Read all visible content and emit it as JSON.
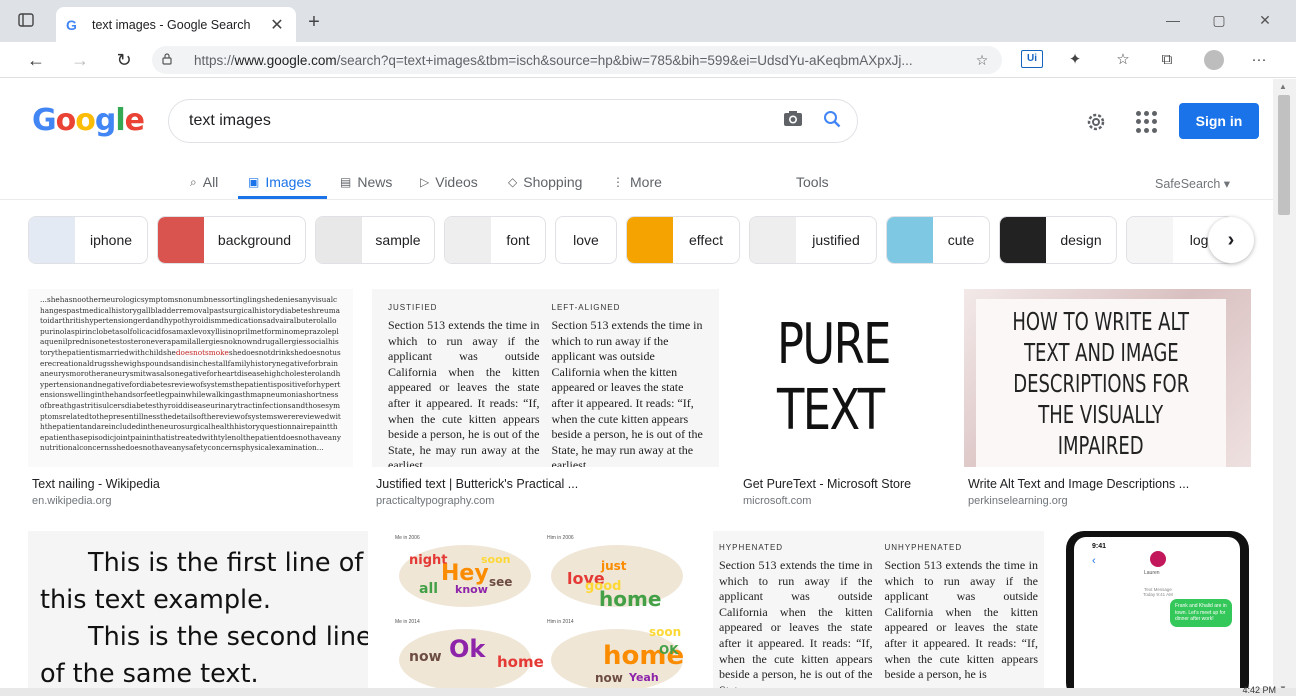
{
  "browser": {
    "tab_title": "text images - Google Search",
    "favicon": "G",
    "new_tab": "+",
    "url_prefix": "https://",
    "url_host": "www.google.com",
    "url_path": "/search?q=text+images&tbm=isch&source=hp&biw=785&bih=599&ei=UdsdYu-aKeqbmAXpxJj...",
    "nav": {
      "back": "←",
      "forward": "→",
      "reload": "↻"
    },
    "window": {
      "minimize": "—",
      "maximize": "▢",
      "close": "✕"
    },
    "tab_close": "✕",
    "toolbar_icons": {
      "ui_badge": "Ui",
      "extensions": "✦",
      "favorites": "☆",
      "collections": "⧉",
      "more": "···"
    }
  },
  "google": {
    "logo_letters": [
      {
        "ch": "G",
        "color": "#4285f4"
      },
      {
        "ch": "o",
        "color": "#ea4335"
      },
      {
        "ch": "o",
        "color": "#fbbc05"
      },
      {
        "ch": "g",
        "color": "#4285f4"
      },
      {
        "ch": "l",
        "color": "#34a853"
      },
      {
        "ch": "e",
        "color": "#ea4335"
      }
    ],
    "query": "text images",
    "sign_in": "Sign in",
    "accent": "#1a73e8"
  },
  "tabs": {
    "all": "All",
    "images": "Images",
    "news": "News",
    "videos": "Videos",
    "shopping": "Shopping",
    "more": "More",
    "tools": "Tools",
    "safesearch": "SafeSearch ▾"
  },
  "chips": [
    "iphone",
    "background",
    "sample",
    "font",
    "love",
    "effect",
    "justified",
    "cute",
    "design",
    "logo"
  ],
  "results": {
    "r1": {
      "caption": "Text nailing - Wikipedia",
      "source": "en.wikipedia.org",
      "text_a": "...shehasnootherneurologicsymptomsnonumbnessortinglingshedeniesanyvisualchangespastmedicalhistorygallbladderremovalpastsurgicalhistorydiabeteshreumatoidarthritishypertensiongerdandhypothyroidismmedicationsadvairalbuterolallopurinolaspirinclobetasolfolicacidfosamaxlevoxyllisinoprilmetforminomeprazoleplaquenilprednisonetestosteroneverapamilallergiesnoknowndrugallergiessocialhistorythepatientismarriedwithchildshe",
      "text_em": "doesnotsmoke",
      "text_b": "shedoesnotdrinkshedoesnotuserecreationaldrugsshewighspoundsandisinchestallfamilyhistorynegativeforbrainaneurysmorotheraneurysmitwasalsonegativeforheartdiseasehighcholesterolandhypertensionandnegativefordiabetesreviewofsystemsthepatientispositiveforhypertensionswellinginthehandsorfeetlegpainwhilewalkingasthmapneumoniashortnessofbreathgastritisulcersdiabetesthyroiddiseaseurinarytractinfectionsandthosesymptomsrelatedtothepresentillnessthedetailsofthereviewofsystemswerereviewedwiththepatientandareincludedinthe­neurosurgicalhealthhistoryquestionnairepaintthepatienthasepisodicjointpaininthatistreatedwithtylenolthepatientdoesnothaveanynutritionalconcernsshedoesnothaveanysafetyconcernsphysicalexamination..."
    },
    "r2": {
      "caption": "Justified text | Butterick's Practical ...",
      "source": "practicaltypography.com",
      "head_left": "JUSTIFIED",
      "head_right": "LEFT-ALIGNED",
      "body_left": "Section 513 extends the time in which to run away if the applicant was outside California when the kitten appeared or leaves the state after it appeared. It reads: “If, when the cute kitten appears beside a person, he is out of the State, he may run away at the earliest",
      "body_right": "Section 513 extends the time in which to run away if the applicant was outside California when the kitten appeared or leaves the state after it appeared. It reads: “If, when the cute kitten appears beside a person, he is out of the State, he may run away at the earliest"
    },
    "r3": {
      "caption": "Get PureText - Microsoft Store",
      "source": "microsoft.com",
      "line1": "PURE",
      "line2": "TEXT"
    },
    "r4": {
      "caption": "Write Alt Text and Image Descriptions ...",
      "source": "perkinselearning.org",
      "lines": [
        "HOW TO WRITE ALT",
        "TEXT AND IMAGE",
        "DESCRIPTIONS FOR",
        "THE VISUALLY",
        "IMPAIRED"
      ]
    },
    "r5": {
      "lines": [
        "This is the first line of",
        "this text example.",
        "This is the second line",
        "of the same text."
      ]
    },
    "r6": {
      "labels": [
        "Me in 2006",
        "Him in 2006",
        "Me in 2014",
        "Him in 2014"
      ],
      "words": [
        "night",
        "Hey",
        "soon",
        "all",
        "know",
        "see",
        "love",
        "just",
        "good",
        "home",
        "Ok",
        "now",
        "home",
        "home",
        "soon",
        "OK",
        "Yeah",
        "now"
      ]
    },
    "r7": {
      "head_left": "HYPHENATED",
      "head_right": "UNHYPHENATED",
      "body_left": "Section 513 extends the time in which to run away if the applicant was outside California when the kitten appeared or leaves the state after it appeared. It reads: “If, when the cute kitten appears beside a person, he is out of the State,",
      "body_right": "Section 513 extends the time in which to run away if the applicant was outside California when the kitten appeared or leaves the state after it appeared. It reads: “If, when the cute kitten appears beside a person, he is"
    },
    "r8": {
      "time": "9:41",
      "name": "Lauren",
      "meta": "Text Message Today 9:41 AM",
      "bubble": "Frank and Khalid are in town. Let's meet up for dinner after work!"
    }
  },
  "taskbar": {
    "time": "4:42 PM"
  }
}
